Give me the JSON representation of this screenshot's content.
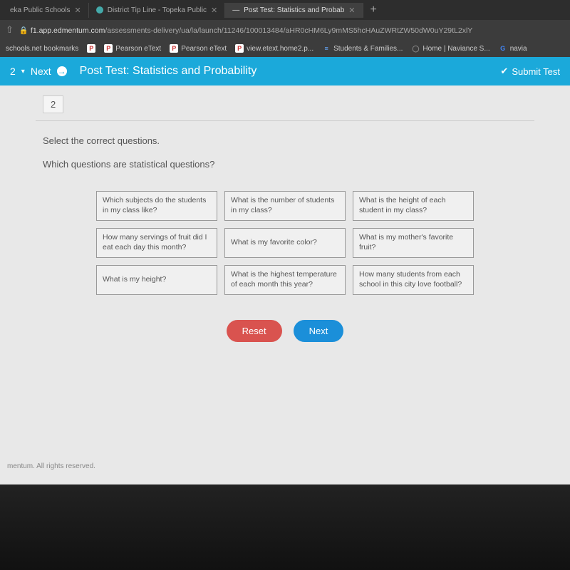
{
  "browser": {
    "tabs": [
      {
        "label": "eka Public Schools",
        "active": false
      },
      {
        "label": "District Tip Line - Topeka Public",
        "active": false
      },
      {
        "label": "Post Test: Statistics and Probab",
        "active": true
      }
    ],
    "url_prefix": "f1.app.edmentum.com",
    "url_path": "/assessments-delivery/ua/la/launch/11246/100013484/aHR0cHM6Ly9mMS5hcHAuZWRtZW50dW0uY29tL2xlY",
    "bookmarks": [
      {
        "label": "schools.net bookmarks",
        "icon": ""
      },
      {
        "label": "",
        "icon": "P"
      },
      {
        "label": "Pearson eText",
        "icon": "P"
      },
      {
        "label": "Pearson eText",
        "icon": "P"
      },
      {
        "label": "view.etext.home2.p...",
        "icon": "P"
      },
      {
        "label": "Students & Families...",
        "icon": "≡"
      },
      {
        "label": "Home | Naviance S...",
        "icon": "◯"
      },
      {
        "label": "navia",
        "icon": "G"
      }
    ]
  },
  "header": {
    "question_num": "2",
    "next_label": "Next",
    "title": "Post Test: Statistics and Probability",
    "submit_label": "Submit Test"
  },
  "question": {
    "number": "2",
    "instruction": "Select the correct questions.",
    "prompt": "Which questions are statistical questions?",
    "options": [
      "Which subjects do the students in my class like?",
      "What is the number of students in my class?",
      "What is the height of each student in my class?",
      "How many servings of fruit did I eat each day this month?",
      "What is my favorite color?",
      "What is my mother's favorite fruit?",
      "What is my height?",
      "What is the highest temperature of each month this year?",
      "How many students from each school in this city love football?"
    ],
    "reset_label": "Reset",
    "next_label": "Next"
  },
  "footer": "mentum. All rights reserved."
}
